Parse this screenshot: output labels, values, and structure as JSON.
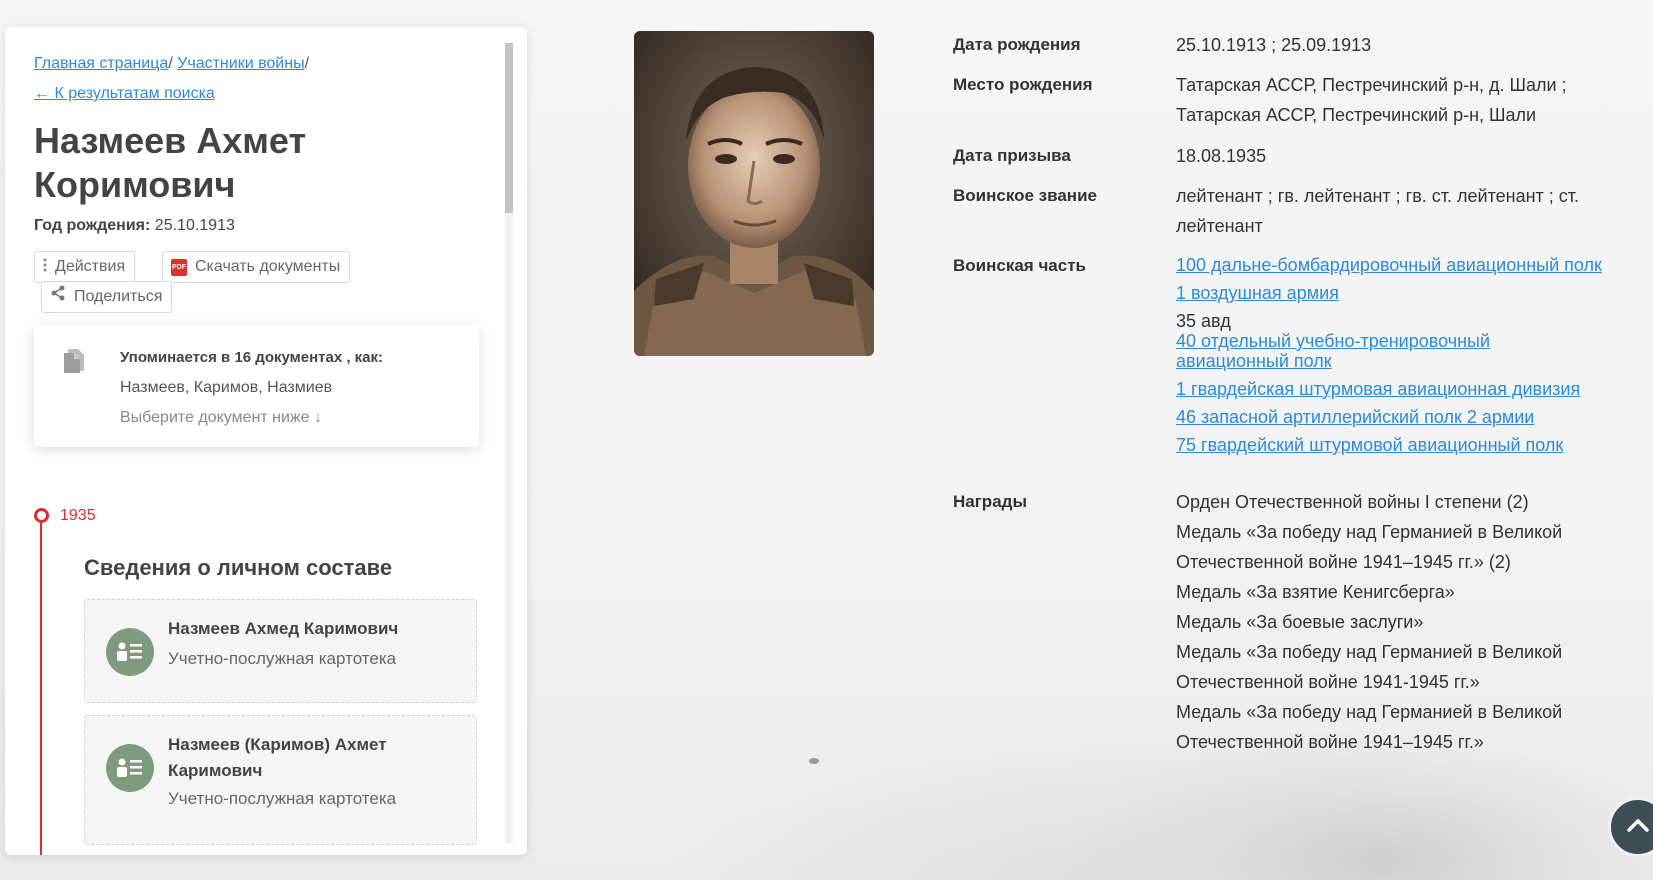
{
  "breadcrumb": {
    "home": "Главная страница",
    "sep1": "/ ",
    "participants": "Участники войны",
    "sep2": "/"
  },
  "back_link": "← К результатам поиска",
  "person": {
    "name": "Назмеев Ахмет Коримович",
    "birth_year_label": "Год рождения:",
    "birth_year_value": "25.10.1913"
  },
  "actions": {
    "actions_label": "Действия",
    "download_label": "Скачать документы",
    "share_label": "Поделиться"
  },
  "mentions": {
    "title": "Упоминается в 16 документах , как:",
    "names": "Назмеев, Каримов, Назмиев",
    "hint": "Выберите документ ниже ↓"
  },
  "timeline": {
    "year": "1935",
    "section_title": "Сведения о личном составе",
    "records": [
      {
        "name": "Назмеев Ахмед Каримович",
        "type": "Учетно-послужная картотека"
      },
      {
        "name": "Назмеев (Каримов) Ахмет Каримович",
        "type": "Учетно-послужная картотека"
      }
    ]
  },
  "details": {
    "birth_date_label": "Дата рождения",
    "birth_date_value": "25.10.1913 ; 25.09.1913",
    "birth_place_label": "Место рождения",
    "birth_place_value": "Татарская АССР, Пестречинский р-н, д. Шали ; Татарская АССР, Пестречинский р-н, Шали",
    "draft_date_label": "Дата призыва",
    "draft_date_value": "18.08.1935",
    "rank_label": "Воинское звание",
    "rank_value": "лейтенант ; гв. лейтенант ; гв. ст. лейтенант ; ст. лейтенант",
    "unit_label": "Воинская часть",
    "units": [
      "100 дальне-бомбардировочный авиационный полк",
      "1 воздушная армия",
      "35 авд",
      "40 отдельный учебно-тренировочный авиационный полк",
      "1 гвардейская штурмовая авиационная дивизия",
      "46 запасной артиллерийский полк 2 армии",
      "75 гвардейский штурмовой авиационный полк"
    ],
    "awards_label": "Награды",
    "awards": [
      "Орден Отечественной войны I степени (2)",
      "Медаль «За победу над Германией в Великой Отечественной войне 1941–1945 гг.» (2)",
      "Медаль «За взятие Кенигсберга»",
      "Медаль «За боевые заслуги»",
      "Медаль «За победу над Германией в Великой Отечественной войне 1941-1945 гг.»",
      "Медаль «За победу над Германией в Великой Отечественной войне 1941–1945 гг.»"
    ]
  },
  "colors": {
    "link": "#2b8ad8",
    "timeline_accent": "#e02b35",
    "avatar_bg": "#7f9a7d",
    "scroll_button": "#3d4f54"
  },
  "icons": {
    "actions": "vertical-dots-icon",
    "download": "pdf-icon",
    "share": "share-icon",
    "mentions": "documents-icon",
    "record": "personnel-card-icon",
    "scroll_up": "chevron-up-icon"
  }
}
